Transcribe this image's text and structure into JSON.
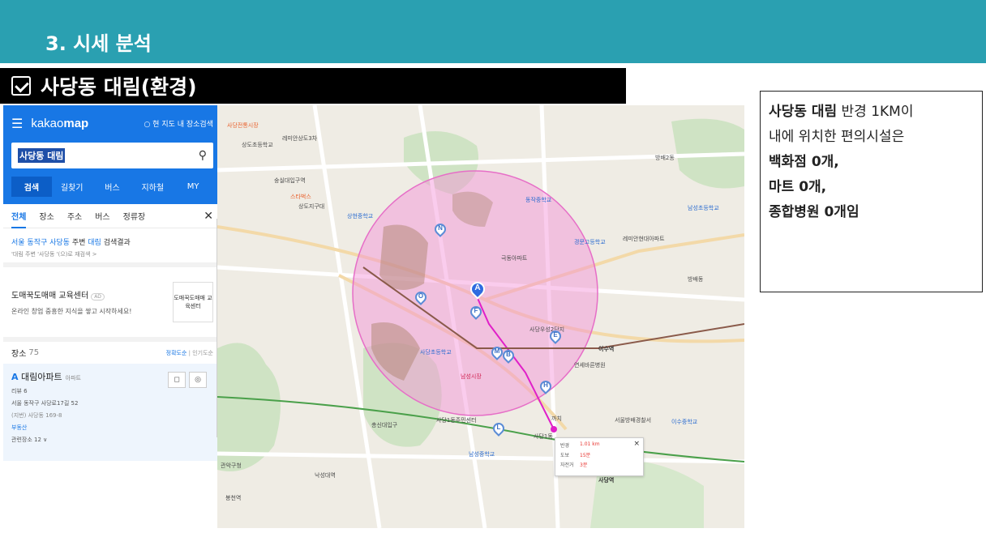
{
  "header": {
    "section_title": "3. 시세 분석",
    "subtitle": "사당동 대림(환경)",
    "band_color": "#2aa0b1"
  },
  "kakao": {
    "logo_light": "kakao",
    "logo_bold": "map",
    "here_search": "현 지도 내 장소검색",
    "search_value": "사당동 대림",
    "tabs": [
      "검색",
      "길찾기",
      "버스",
      "지하철",
      "MY"
    ],
    "categories": [
      "전체",
      "장소",
      "주소",
      "버스",
      "정류장"
    ],
    "result_prefix": "서울 동작구 사당동",
    "result_mid": " 주변 ",
    "result_keyword": "대림",
    "result_suffix": " 검색결과",
    "result_sub": "'대림 주변 '사당동 '(으)로 재검색 >",
    "ad_title": "도매꾹도매매 교육센터",
    "ad_badge": "AD",
    "ad_desc": "온라인 창업 중흥한 지식을 쌓고 시작하세요!",
    "ad_logo": "도매꾹도매매 교육센터",
    "places_label": "장소",
    "places_count": "75",
    "sort_active": "정확도순",
    "sort_sep": " | ",
    "sort_alt": "인기도순",
    "item": {
      "letter": "A",
      "name": "대림아파트",
      "type": "아파트",
      "review": "리뷰 6",
      "address": "서울 동작구 사당로17길 52",
      "jibun": "(지번) 사당동 169-8",
      "realestate": "부동산",
      "related": "관련장소 12 ∨"
    }
  },
  "map": {
    "labels": [
      {
        "t": "사당전통시장",
        "c": "orange"
      },
      {
        "t": "상도초등학교",
        "c": ""
      },
      {
        "t": "레미안상도3차",
        "c": ""
      },
      {
        "t": "숭실대입구역",
        "c": ""
      },
      {
        "t": "스타벅스",
        "c": "orange"
      },
      {
        "t": "상도지구대",
        "c": ""
      },
      {
        "t": "상현중학교",
        "c": "blue"
      },
      {
        "t": "남성초등학교",
        "c": "blue"
      },
      {
        "t": "사당1동",
        "c": ""
      },
      {
        "t": "동작중학교",
        "c": "blue"
      },
      {
        "t": "사당우성2단지",
        "c": ""
      },
      {
        "t": "극동아파트",
        "c": ""
      },
      {
        "t": "경문고등학교",
        "c": "blue"
      },
      {
        "t": "레미안현대아파트",
        "c": ""
      },
      {
        "t": "방배2동",
        "c": ""
      },
      {
        "t": "이수역",
        "c": ""
      },
      {
        "t": "사당역",
        "c": "bold"
      },
      {
        "t": "관악구청",
        "c": ""
      },
      {
        "t": "낙성대역",
        "c": ""
      },
      {
        "t": "봉천역",
        "c": ""
      },
      {
        "t": "남성시장",
        "c": "red"
      },
      {
        "t": "사당초등학교",
        "c": "blue"
      },
      {
        "t": "서울방배경찰서",
        "c": ""
      },
      {
        "t": "이수중학교",
        "c": "blue"
      },
      {
        "t": "남성중학교",
        "c": "blue"
      },
      {
        "t": "까치",
        "c": ""
      },
      {
        "t": "방배동",
        "c": ""
      },
      {
        "t": "연세바른병원",
        "c": ""
      },
      {
        "t": "총신대입구",
        "c": ""
      },
      {
        "t": "사당1동주민센터",
        "c": ""
      }
    ],
    "pins": [
      "N",
      "O",
      "A",
      "F",
      "M",
      "B",
      "E",
      "H",
      "L"
    ],
    "popup": {
      "r1_k": "반경",
      "r1_v": "1.01 km",
      "r2_k": "도보",
      "r2_v": "15분",
      "r3_k": "자전거",
      "r3_v": "3분",
      "close": "×"
    },
    "radius_color": "#f58fd8"
  },
  "info": {
    "bold1": "사당동 대림",
    "line1": " 반경 1KM이",
    "line2": "내에 위치한 편의시설은",
    "line3": "백화점 0개,",
    "line4": "마트 0개,",
    "line5": "종합병원 0개임"
  }
}
